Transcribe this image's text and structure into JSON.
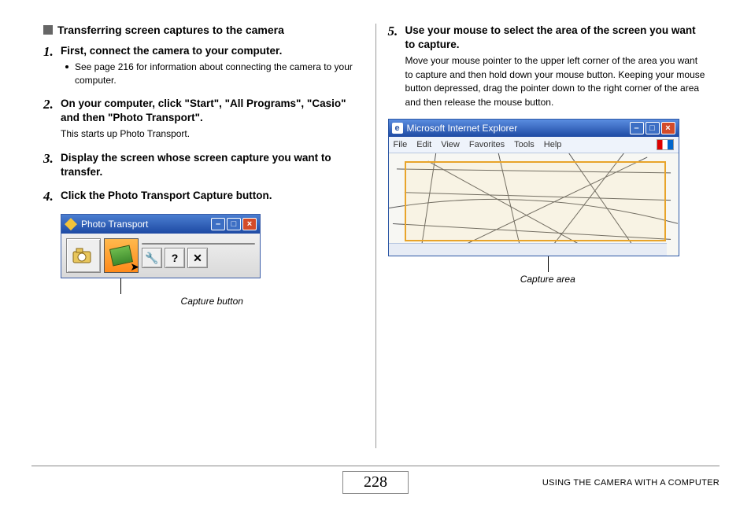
{
  "section_title": "Transferring screen captures to the camera",
  "steps_left": [
    {
      "num": "1.",
      "title": "First, connect the camera to your computer.",
      "bullet": "See page 216 for information about connecting the camera to your computer."
    },
    {
      "num": "2.",
      "title": "On your computer, click \"Start\", \"All Programs\", \"Casio\" and then \"Photo Transport\".",
      "desc": "This starts up Photo Transport."
    },
    {
      "num": "3.",
      "title": "Display the screen whose screen capture you want to transfer."
    },
    {
      "num": "4.",
      "title": "Click the Photo Transport Capture button."
    }
  ],
  "photo_transport": {
    "window_title": "Photo Transport",
    "buttons": {
      "wrench": "🔧",
      "help": "?",
      "close": "✕"
    }
  },
  "caption_left": "Capture button",
  "steps_right": [
    {
      "num": "5.",
      "title": "Use your mouse to select the area of the screen you want to capture.",
      "desc": "Move your mouse pointer to the upper left corner of the area you want to capture and then hold down your mouse button. Keeping your mouse button depressed, drag the pointer down to the right corner of the area and then release the mouse button."
    }
  ],
  "ie": {
    "window_title": "Microsoft Internet Explorer",
    "menu": [
      "File",
      "Edit",
      "View",
      "Favorites",
      "Tools",
      "Help"
    ]
  },
  "caption_right": "Capture area",
  "page_number": "228",
  "footer_label": "USING THE CAMERA WITH A COMPUTER"
}
